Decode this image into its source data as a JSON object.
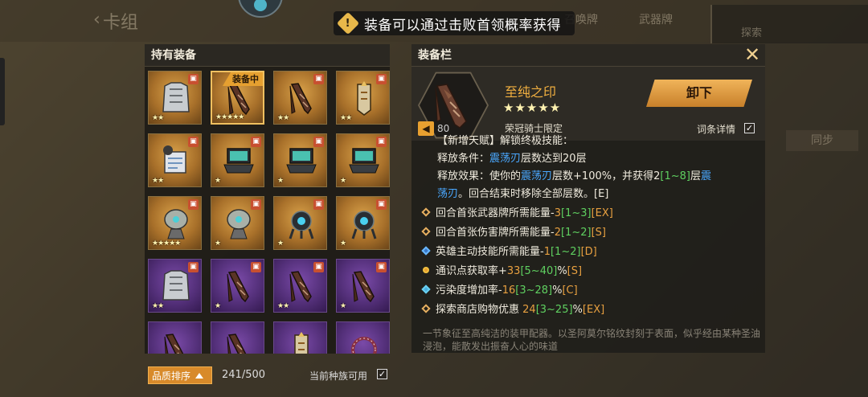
{
  "background": {
    "title": "卡组",
    "tabs": [
      "召唤牌",
      "武器牌",
      "探索"
    ],
    "right_button": "同步"
  },
  "notice": {
    "icon": "warning-icon",
    "text": "装备可以通过击败首领概率获得"
  },
  "inventory": {
    "title": "持有装备",
    "items": [
      {
        "art": "armor-icon",
        "rarity": "gold",
        "stars": "★★",
        "locked": true
      },
      {
        "art": "scarf-icon",
        "rarity": "gold",
        "stars": "★★★★★",
        "equipped": true
      },
      {
        "art": "scarf-icon",
        "rarity": "gold",
        "stars": "★★",
        "locked": true
      },
      {
        "art": "banner-icon",
        "rarity": "gold",
        "stars": "★★",
        "locked": true
      },
      {
        "art": "device-icon",
        "rarity": "gold",
        "stars": "★★",
        "locked": true
      },
      {
        "art": "laptop-icon",
        "rarity": "gold",
        "stars": "★",
        "locked": true
      },
      {
        "art": "laptop-icon",
        "rarity": "gold",
        "stars": "★",
        "locked": true
      },
      {
        "art": "laptop-icon",
        "rarity": "gold",
        "stars": "★",
        "locked": true
      },
      {
        "art": "radar-icon",
        "rarity": "gold",
        "stars": "★★★★★",
        "locked": true
      },
      {
        "art": "radar-icon",
        "rarity": "gold",
        "stars": "★",
        "locked": true
      },
      {
        "art": "drone-icon",
        "rarity": "gold",
        "stars": "★",
        "locked": true
      },
      {
        "art": "drone-icon",
        "rarity": "gold",
        "stars": "★",
        "locked": true
      },
      {
        "art": "armor-icon",
        "rarity": "purple",
        "stars": "★★",
        "locked": true
      },
      {
        "art": "scarf-icon",
        "rarity": "purple",
        "stars": "★",
        "locked": true
      },
      {
        "art": "scarf-icon",
        "rarity": "purple",
        "stars": "★★",
        "locked": true
      },
      {
        "art": "scarf-icon",
        "rarity": "purple",
        "stars": "★",
        "locked": true
      },
      {
        "art": "scarf-icon",
        "rarity": "purple",
        "stars": "",
        "locked": false
      },
      {
        "art": "scarf-icon",
        "rarity": "purple",
        "stars": "",
        "locked": false
      },
      {
        "art": "banner-icon",
        "rarity": "purple",
        "stars": "",
        "locked": false
      },
      {
        "art": "thorn-ring-icon",
        "rarity": "purple",
        "stars": "",
        "locked": false
      }
    ],
    "equipped_tag": "装备中",
    "sort_label": "品质排序",
    "count": "241/500",
    "race_filter_label": "当前种族可用",
    "race_filter_checked": "✓"
  },
  "detail": {
    "title": "装备栏",
    "close": "✕",
    "item_name": "至纯之印",
    "stars": "★★★★★",
    "level": "80",
    "limit": "荣冠骑士限定",
    "unequip": "卸下",
    "affix_detail": "词条详情",
    "affix_checked": "✓",
    "talent_line": "【新增天赋】解锁终极技能：",
    "cond_prefix": "释放条件：",
    "cond_kw": "震荡刃",
    "cond_suffix": "层数达到20层",
    "eff_prefix": "释放效果：使你的",
    "eff_kw": "震荡刃",
    "eff_mid": "层数+100%，并获得2",
    "eff_range": "[1~8]",
    "eff_mid2": "层",
    "eff_kw2": "震",
    "eff_kw3": "荡刃",
    "eff_suffix": "。回合结束时移除全部层数。[E]",
    "affixes": [
      {
        "text": "回合首张武器牌所需能量-",
        "num": "3",
        "range": "[1~3]",
        "unit": "",
        "tier": "[EX]",
        "bullet": "normal"
      },
      {
        "text": "回合首张伤害牌所需能量-",
        "num": "2",
        "range": "[1~2]",
        "unit": "",
        "tier": "[S]",
        "bullet": "normal"
      },
      {
        "text": "英雄主动技能所需能量-",
        "num": "1",
        "range": "[1~2]",
        "unit": "",
        "tier": "[D]",
        "bullet": "blue"
      },
      {
        "text": "通识点获取率+",
        "num": "33",
        "range": "[5~40]",
        "unit": "%",
        "tier": "[S]",
        "bullet": "coin"
      },
      {
        "text": "污染度增加率-",
        "num": "16",
        "range": "[3~28]",
        "unit": "%",
        "tier": "[C]",
        "bullet": "cyan"
      },
      {
        "text": "探索商店购物优惠 ",
        "num": "24",
        "range": "[3~25]",
        "unit": "%",
        "tier": "[EX]",
        "bullet": "normal"
      }
    ],
    "flavor": "一节象征至高纯洁的装甲配器。以圣阿莫尔铭纹封刻于表面，似乎经由某种圣油浸泡，能散发出振奋人心的味道"
  }
}
